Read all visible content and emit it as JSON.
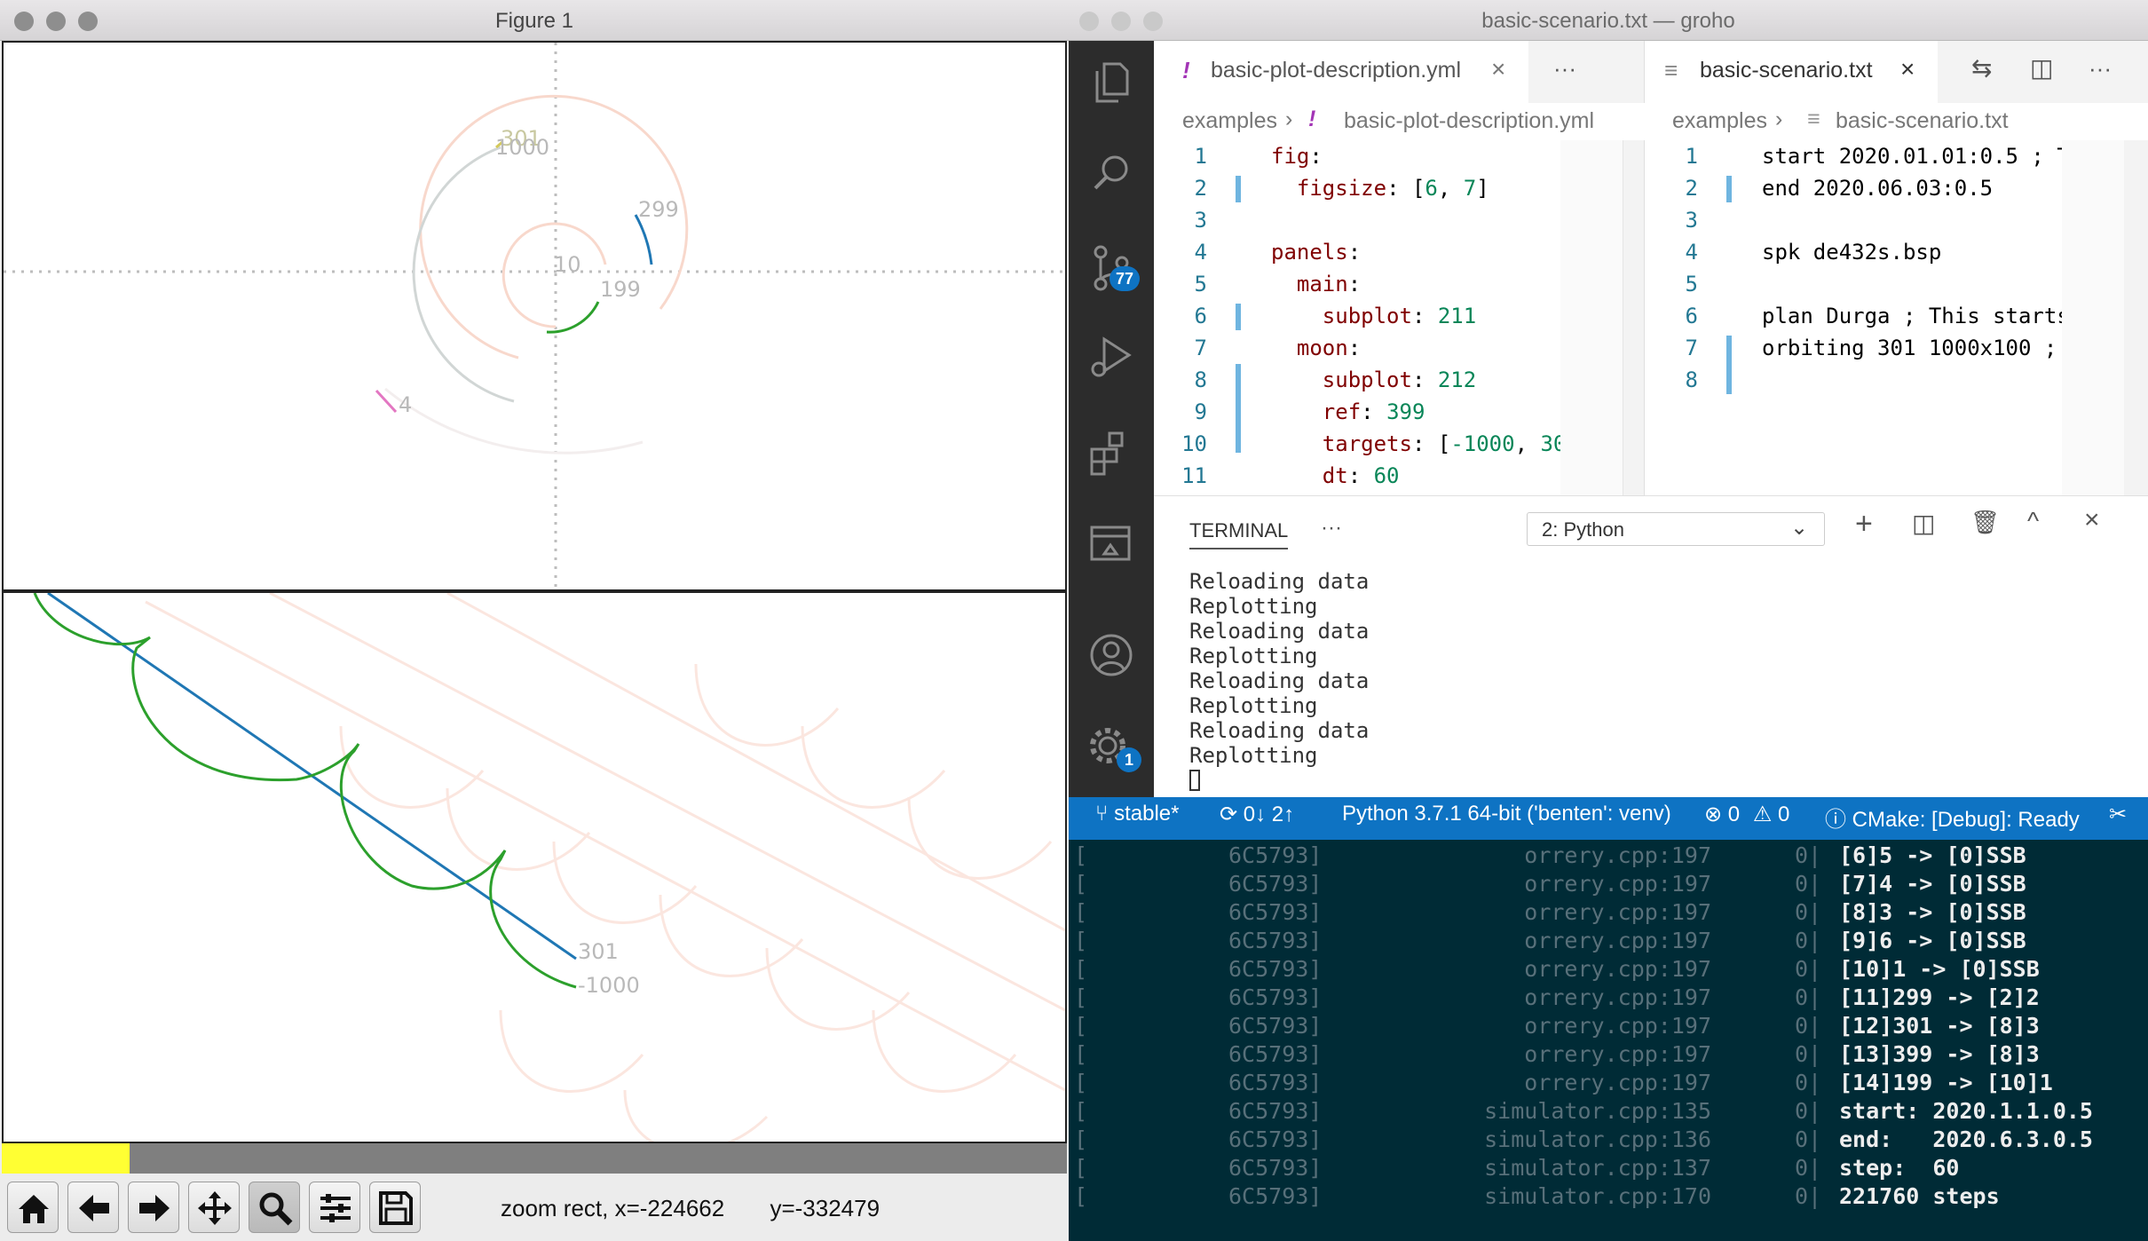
{
  "figure": {
    "title": "Figure 1",
    "top_labels": [
      "301",
      "1000",
      "299",
      "10",
      "199",
      "4"
    ],
    "bottom_labels": [
      "301",
      "-1000"
    ],
    "progress_fraction": 0.12,
    "status": {
      "mode": "zoom rect, x=-224662",
      "y": "y=-332479"
    },
    "toolbar_icons": [
      "home-icon",
      "back-arrow-icon",
      "forward-arrow-icon",
      "pan-icon",
      "zoom-icon",
      "configure-subplots-icon",
      "save-icon"
    ]
  },
  "editor": {
    "title": "basic-scenario.txt — groho",
    "left_tab": {
      "mark": "!",
      "name": "basic-plot-description.yml",
      "crumb1": "examples",
      "crumb2": "basic-plot-description.yml"
    },
    "right_tab": {
      "name": "basic-scenario.txt",
      "crumb1": "examples",
      "crumb2": "basic-scenario.txt"
    },
    "more": "···",
    "source_control_badge": "77",
    "settings_badge": "1",
    "yml_lines": [
      {
        "n": "1",
        "t": "fig:"
      },
      {
        "n": "2",
        "t": "  figsize: [6, 7]"
      },
      {
        "n": "3",
        "t": ""
      },
      {
        "n": "4",
        "t": "panels:"
      },
      {
        "n": "5",
        "t": "  main:"
      },
      {
        "n": "6",
        "t": "    subplot: 211"
      },
      {
        "n": "7",
        "t": "  moon:"
      },
      {
        "n": "8",
        "t": "    subplot: 212"
      },
      {
        "n": "9",
        "t": "    ref: 399"
      },
      {
        "n": "10",
        "t": "    targets: [-1000, 30"
      },
      {
        "n": "11",
        "t": "    dt: 60"
      }
    ],
    "txt_lines": [
      {
        "n": "1",
        "t": "start 2020.01.01:0.5 ; T"
      },
      {
        "n": "2",
        "t": "end 2020.06.03:0.5"
      },
      {
        "n": "3",
        "t": ""
      },
      {
        "n": "4",
        "t": "spk de432s.bsp"
      },
      {
        "n": "5",
        "t": ""
      },
      {
        "n": "6",
        "t": "plan Durga ; This starts"
      },
      {
        "n": "7",
        "t": "orbiting 301 1000x100 ;"
      },
      {
        "n": "8",
        "t": ""
      }
    ],
    "terminal": {
      "tab": "TERMINAL",
      "select": "2: Python",
      "lines": [
        "Reloading data",
        "Replotting",
        "Reloading data",
        "Replotting",
        "Reloading data",
        "Replotting",
        "Reloading data",
        "Replotting"
      ]
    },
    "statusbar": {
      "branch": "stable*",
      "sync": "0↓ 2↑",
      "python": "Python 3.7.1 64-bit ('benten': venv)",
      "errors": "0",
      "warnings": "0",
      "cmake": "CMake: [Debug]: Ready"
    }
  },
  "log": [
    {
      "a": "[",
      "b": "6C5793]",
      "c": "orrery.cpp:197",
      "d": "0|",
      "e": "[6]5 -> [0]SSB"
    },
    {
      "a": "[",
      "b": "6C5793]",
      "c": "orrery.cpp:197",
      "d": "0|",
      "e": "[7]4 -> [0]SSB"
    },
    {
      "a": "[",
      "b": "6C5793]",
      "c": "orrery.cpp:197",
      "d": "0|",
      "e": "[8]3 -> [0]SSB"
    },
    {
      "a": "[",
      "b": "6C5793]",
      "c": "orrery.cpp:197",
      "d": "0|",
      "e": "[9]6 -> [0]SSB"
    },
    {
      "a": "[",
      "b": "6C5793]",
      "c": "orrery.cpp:197",
      "d": "0|",
      "e": "[10]1 -> [0]SSB"
    },
    {
      "a": "[",
      "b": "6C5793]",
      "c": "orrery.cpp:197",
      "d": "0|",
      "e": "[11]299 -> [2]2"
    },
    {
      "a": "[",
      "b": "6C5793]",
      "c": "orrery.cpp:197",
      "d": "0|",
      "e": "[12]301 -> [8]3"
    },
    {
      "a": "[",
      "b": "6C5793]",
      "c": "orrery.cpp:197",
      "d": "0|",
      "e": "[13]399 -> [8]3"
    },
    {
      "a": "[",
      "b": "6C5793]",
      "c": "orrery.cpp:197",
      "d": "0|",
      "e": "[14]199 -> [10]1"
    },
    {
      "a": "[",
      "b": "6C5793]",
      "c": "simulator.cpp:135",
      "d": "0|",
      "e": "start: 2020.1.1.0.5"
    },
    {
      "a": "[",
      "b": "6C5793]",
      "c": "simulator.cpp:136",
      "d": "0|",
      "e": "end:   2020.6.3.0.5"
    },
    {
      "a": "[",
      "b": "6C5793]",
      "c": "simulator.cpp:137",
      "d": "0|",
      "e": "step:  60"
    },
    {
      "a": "[",
      "b": "6C5793]",
      "c": "simulator.cpp:170",
      "d": "0|",
      "e": "221760 steps"
    }
  ],
  "colors": {
    "vscode_blue": "#0e73c3",
    "activity_bar": "#2c2c2c",
    "log_bg": "#002b36",
    "progress": "#ffff33",
    "green": "#2ca02c",
    "blue": "#1f77b4"
  }
}
